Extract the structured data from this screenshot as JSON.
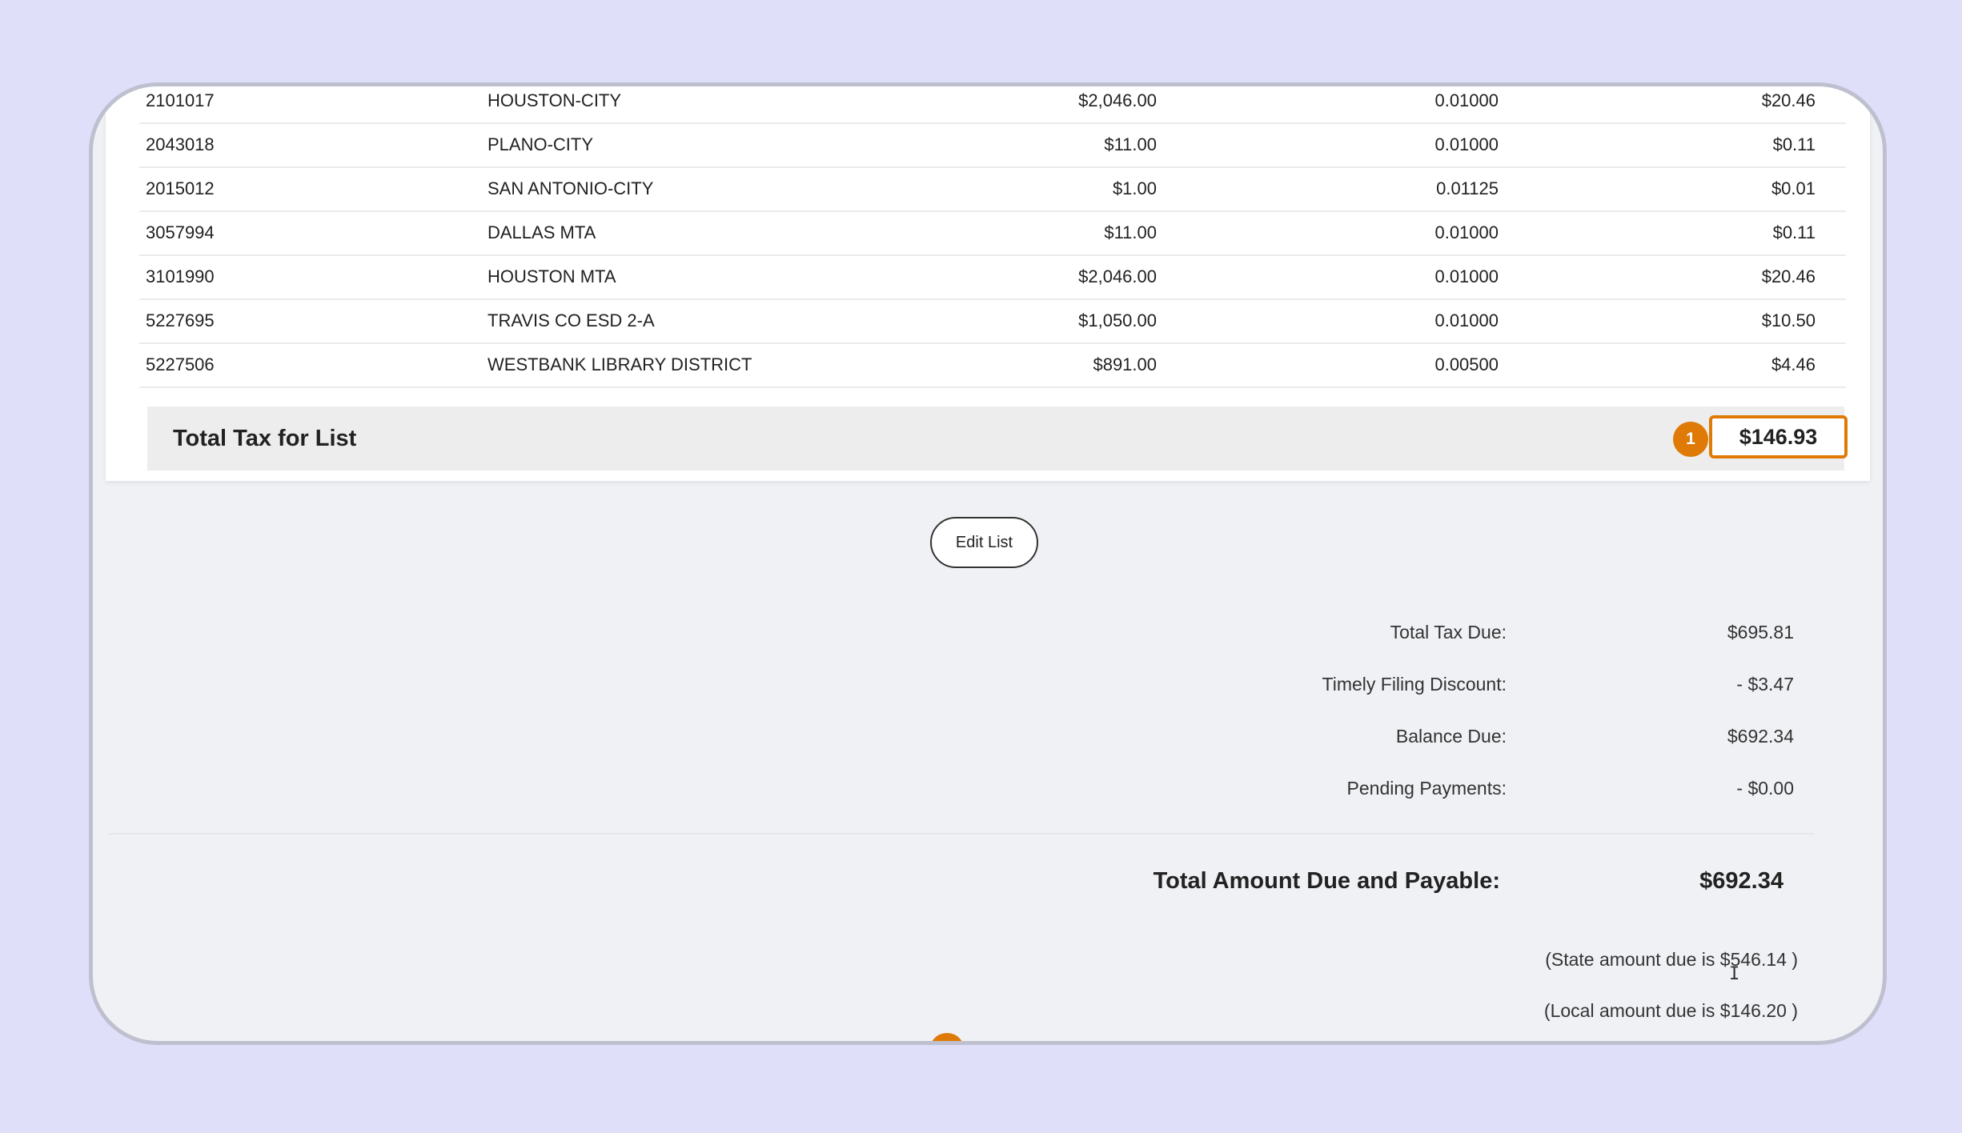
{
  "table": {
    "rows": [
      {
        "id": "2101017",
        "name": "HOUSTON-CITY",
        "gross": "$2,046.00",
        "rate": "0.01000",
        "tax": "$20.46"
      },
      {
        "id": "2043018",
        "name": "PLANO-CITY",
        "gross": "$11.00",
        "rate": "0.01000",
        "tax": "$0.11"
      },
      {
        "id": "2015012",
        "name": "SAN ANTONIO-CITY",
        "gross": "$1.00",
        "rate": "0.01125",
        "tax": "$0.01"
      },
      {
        "id": "3057994",
        "name": "DALLAS MTA",
        "gross": "$11.00",
        "rate": "0.01000",
        "tax": "$0.11"
      },
      {
        "id": "3101990",
        "name": "HOUSTON MTA",
        "gross": "$2,046.00",
        "rate": "0.01000",
        "tax": "$20.46"
      },
      {
        "id": "5227695",
        "name": "TRAVIS CO ESD 2-A",
        "gross": "$1,050.00",
        "rate": "0.01000",
        "tax": "$10.50"
      },
      {
        "id": "5227506",
        "name": "WESTBANK LIBRARY DISTRICT",
        "gross": "$891.00",
        "rate": "0.00500",
        "tax": "$4.46"
      }
    ],
    "total_label": "Total Tax for List",
    "total_value": "$146.93",
    "step_badge": "1"
  },
  "edit_button_label": "Edit List",
  "summary": {
    "total_tax_due_label": "Total Tax Due:",
    "total_tax_due_value": "$695.81",
    "discount_label": "Timely Filing Discount:",
    "discount_value": "- $3.47",
    "balance_due_label": "Balance Due:",
    "balance_due_value": "$692.34",
    "pending_label": "Pending Payments:",
    "pending_value": "- $0.00",
    "grand_total_label": "Total Amount Due and Payable:",
    "grand_total_value": "$692.34",
    "state_note": "(State amount due is $546.14 )",
    "local_note": "(Local amount due is $146.20 )"
  },
  "colors": {
    "accent": "#e07a07",
    "page_background": "#dfdffa",
    "panel_background": "#f0f1f5"
  }
}
